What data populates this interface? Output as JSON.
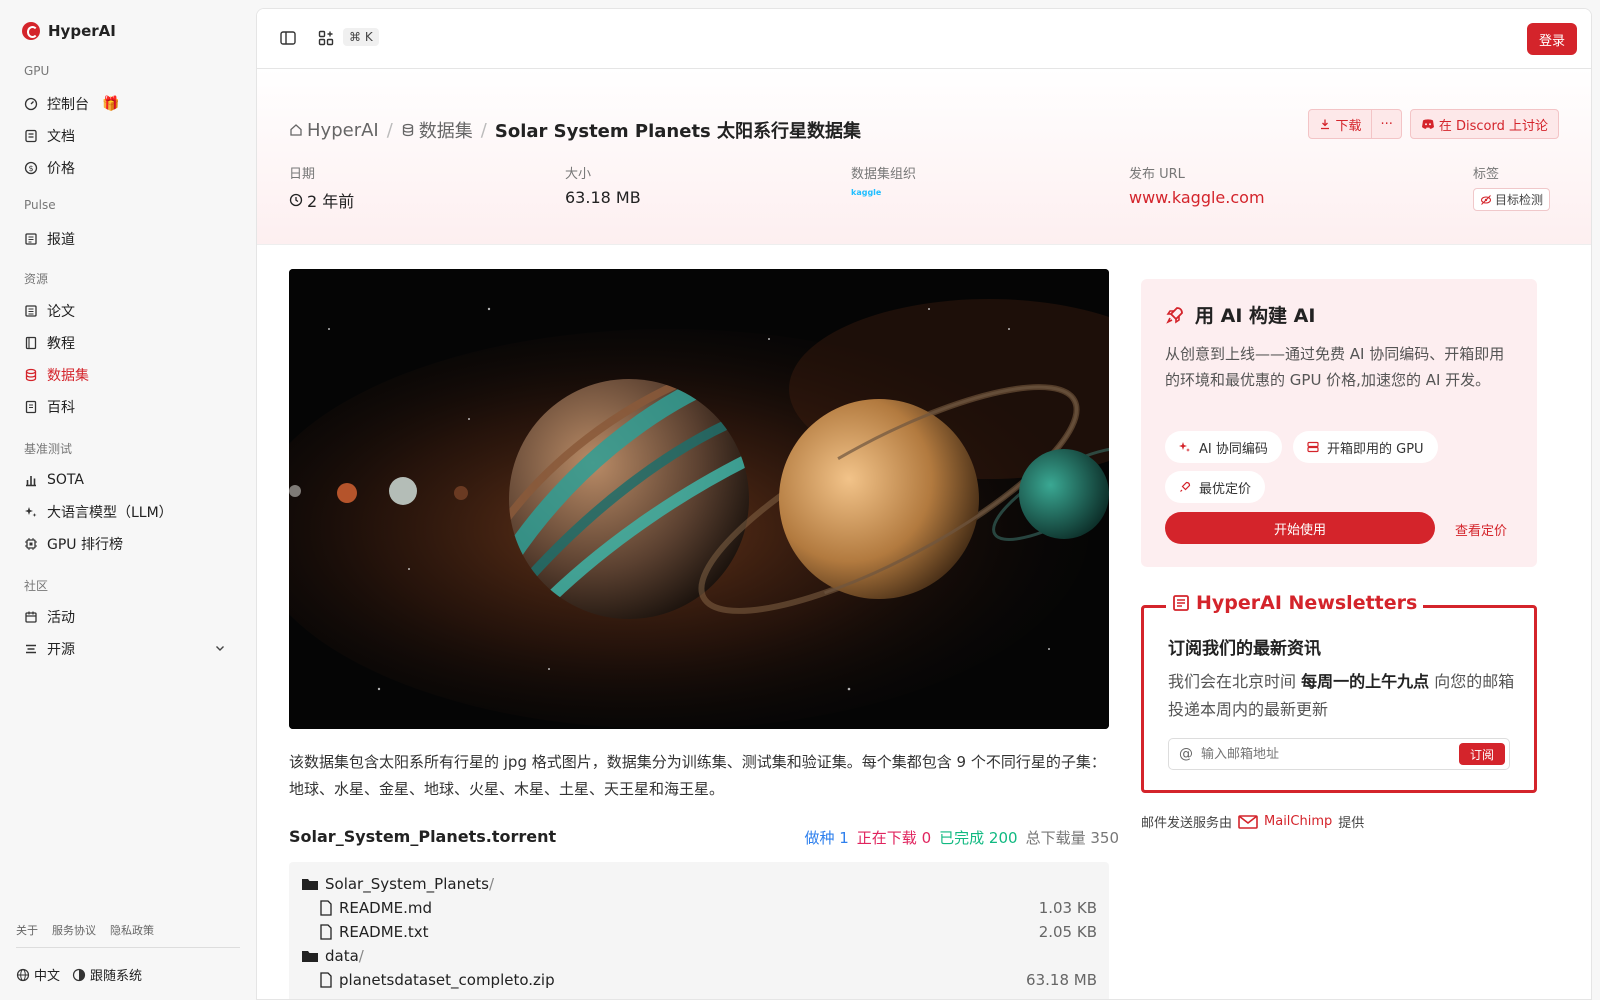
{
  "sidebar": {
    "brand": "HyperAI",
    "sections": {
      "gpu": "GPU",
      "pulse": "Pulse",
      "resources": "资源",
      "bench": "基准测试",
      "community": "社区"
    },
    "items": {
      "console": "控制台",
      "docs": "文档",
      "price": "价格",
      "news": "报道",
      "papers": "论文",
      "tutorials": "教程",
      "datasets": "数据集",
      "wiki": "百科",
      "sota": "SOTA",
      "llm": "大语言模型（LLM）",
      "gpu_rank": "GPU 排行榜",
      "events": "活动",
      "opensource": "开源"
    },
    "footer": {
      "about": "关于",
      "terms": "服务协议",
      "privacy": "隐私政策",
      "lang": "中文",
      "theme": "跟随系统"
    }
  },
  "topbar": {
    "shortcut": "⌘ K",
    "login": "登录"
  },
  "header": {
    "breadcrumb": {
      "home": "HyperAI",
      "section": "数据集",
      "current": "Solar System Planets 太阳系行星数据集"
    },
    "download": "下载",
    "more": "···",
    "discord": "在 Discord 上讨论",
    "meta": {
      "date_label": "日期",
      "date_value": "2 年前",
      "size_label": "大小",
      "size_value": "63.18 MB",
      "org_label": "数据集组织",
      "org_value": "kaggle",
      "url_label": "发布 URL",
      "url_value": "www.kaggle.com",
      "tags_label": "标签",
      "tag": "目标检测"
    }
  },
  "content": {
    "description": "该数据集包含太阳系所有行星的 jpg 格式图片，数据集分为训练集、测试集和验证集。每个集都包含 9 个不同行星的子集：地球、水星、金星、地球、火星、木星、土星、天王星和海王星。",
    "torrent_name": "Solar_System_Planets.torrent",
    "stats": {
      "seeding_label": "做种",
      "seeding": "1",
      "downloading_label": "正在下载",
      "downloading": "0",
      "completed_label": "已完成",
      "completed": "200",
      "total_label": "总下载量",
      "total": "350"
    },
    "files": [
      {
        "name": "Solar_System_Planets",
        "sep": "/",
        "size": ""
      },
      {
        "name": "README.md",
        "size": "1.03 KB"
      },
      {
        "name": "README.txt",
        "size": "2.05 KB"
      },
      {
        "name": "data",
        "sep": "/",
        "size": ""
      },
      {
        "name": "planetsdataset_completo.zip",
        "size": "63.18 MB"
      }
    ]
  },
  "promo": {
    "title": "用 AI 构建 AI",
    "text": "从创意到上线——通过免费 AI 协同编码、开箱即用的环境和最优惠的 GPU 价格,加速您的 AI 开发。",
    "chips": [
      "AI 协同编码",
      "开箱即用的 GPU",
      "最优定价"
    ],
    "start": "开始使用",
    "view_price": "查看定价"
  },
  "newsletter": {
    "legend": "HyperAI Newsletters",
    "title": "订阅我们的最新资讯",
    "text_pre": "我们会在北京时间 ",
    "text_bold": "每周一的上午九点",
    "text_post": " 向您的邮箱投递本周内的最新更新",
    "placeholder": "输入邮箱地址",
    "subscribe": "订阅",
    "by_pre": "邮件发送服务由",
    "by_service": "MailChimp",
    "by_post": "提供"
  },
  "colors": {
    "accent": "#d4242b",
    "seeding": "#2f80ed",
    "downloading": "#e0245e",
    "completed": "#10b981",
    "total": "#777777"
  }
}
